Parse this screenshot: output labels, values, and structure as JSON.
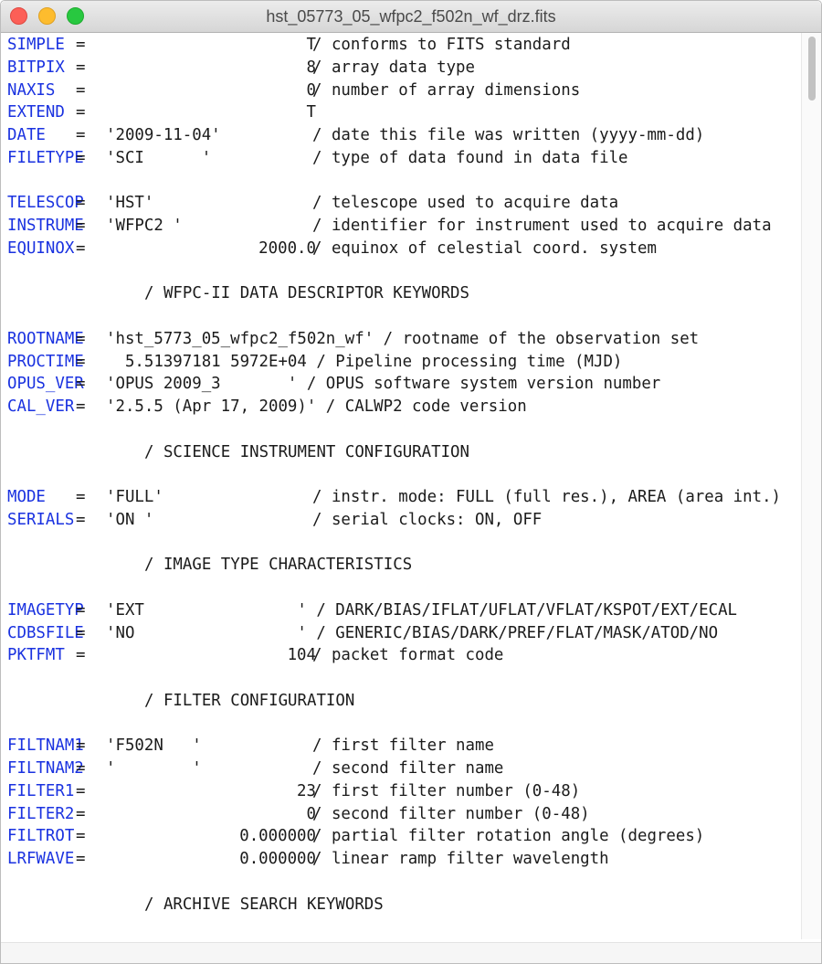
{
  "window": {
    "title": "hst_05773_05_wfpc2_f502n_wf_drz.fits"
  },
  "header_cards": [
    {
      "type": "card",
      "key": "SIMPLE",
      "eq": "=",
      "num": "T",
      "comment": "/ conforms to FITS standard"
    },
    {
      "type": "card",
      "key": "BITPIX",
      "eq": "=",
      "num": "8",
      "comment": "/ array data type"
    },
    {
      "type": "card",
      "key": "NAXIS",
      "eq": "=",
      "num": "0",
      "comment": "/ number of array dimensions"
    },
    {
      "type": "card",
      "key": "EXTEND",
      "eq": "=",
      "num": "T"
    },
    {
      "type": "card",
      "key": "DATE",
      "eq": "=",
      "str": "'2009-11-04'",
      "comment": "/ date this file was written (yyyy-mm-dd)"
    },
    {
      "type": "card",
      "key": "FILETYPE",
      "eq": "=",
      "str": "'SCI      '",
      "comment": "/ type of data found in data file"
    },
    {
      "type": "blank"
    },
    {
      "type": "card",
      "key": "TELESCOP",
      "eq": "=",
      "str": "'HST'",
      "comment": "/ telescope used to acquire data"
    },
    {
      "type": "card",
      "key": "INSTRUME",
      "eq": "=",
      "str": "'WFPC2 '",
      "comment": "/ identifier for instrument used to acquire data"
    },
    {
      "type": "card",
      "key": "EQUINOX",
      "eq": "=",
      "num": "2000.0",
      "comment": "/ equinox of celestial coord. system"
    },
    {
      "type": "blank"
    },
    {
      "type": "section",
      "text": "/ WFPC-II DATA DESCRIPTOR KEYWORDS"
    },
    {
      "type": "blank"
    },
    {
      "type": "card",
      "key": "ROOTNAME",
      "eq": "=",
      "free": "'hst_5773_05_wfpc2_f502n_wf' / rootname of the observation set"
    },
    {
      "type": "card",
      "key": "PROCTIME",
      "eq": "=",
      "free": "  5.51397181 5972E+04 / Pipeline processing time (MJD)"
    },
    {
      "type": "card",
      "key": "OPUS_VER",
      "eq": "=",
      "free": "'OPUS 2009_3       ' / OPUS software system version number"
    },
    {
      "type": "card",
      "key": "CAL_VER",
      "eq": "=",
      "free": "'2.5.5 (Apr 17, 2009)' / CALWP2 code version"
    },
    {
      "type": "blank"
    },
    {
      "type": "section",
      "text": "/ SCIENCE INSTRUMENT CONFIGURATION"
    },
    {
      "type": "blank"
    },
    {
      "type": "card",
      "key": "MODE",
      "eq": "=",
      "str": "'FULL'",
      "comment": "/ instr. mode: FULL (full res.), AREA (area int.)"
    },
    {
      "type": "card",
      "key": "SERIALS",
      "eq": "=",
      "str": "'ON '",
      "comment": "/ serial clocks: ON, OFF"
    },
    {
      "type": "blank"
    },
    {
      "type": "section",
      "text": "/ IMAGE TYPE CHARACTERISTICS"
    },
    {
      "type": "blank"
    },
    {
      "type": "card",
      "key": "IMAGETYP",
      "eq": "=",
      "free": "'EXT                ' / DARK/BIAS/IFLAT/UFLAT/VFLAT/KSPOT/EXT/ECAL"
    },
    {
      "type": "card",
      "key": "CDBSFILE",
      "eq": "=",
      "free": "'NO                 ' / GENERIC/BIAS/DARK/PREF/FLAT/MASK/ATOD/NO"
    },
    {
      "type": "card",
      "key": "PKTFMT",
      "eq": "=",
      "num": "104",
      "comment": "/ packet format code"
    },
    {
      "type": "blank"
    },
    {
      "type": "section",
      "text": "/ FILTER CONFIGURATION"
    },
    {
      "type": "blank"
    },
    {
      "type": "card",
      "key": "FILTNAM1",
      "eq": "=",
      "str": "'F502N   '",
      "comment": "/ first filter name"
    },
    {
      "type": "card",
      "key": "FILTNAM2",
      "eq": "=",
      "str": "'        '",
      "comment": "/ second filter name"
    },
    {
      "type": "card",
      "key": "FILTER1",
      "eq": "=",
      "num": "23",
      "comment": "/ first filter number (0-48)"
    },
    {
      "type": "card",
      "key": "FILTER2",
      "eq": "=",
      "num": "0",
      "comment": "/ second filter number (0-48)"
    },
    {
      "type": "card",
      "key": "FILTROT",
      "eq": "=",
      "num": "0.000000",
      "comment": "/ partial filter rotation angle (degrees)"
    },
    {
      "type": "card",
      "key": "LRFWAVE",
      "eq": "=",
      "num": "0.000000",
      "comment": "/ linear ramp filter wavelength"
    },
    {
      "type": "blank"
    },
    {
      "type": "section",
      "text": "/ ARCHIVE SEARCH KEYWORDS"
    }
  ]
}
